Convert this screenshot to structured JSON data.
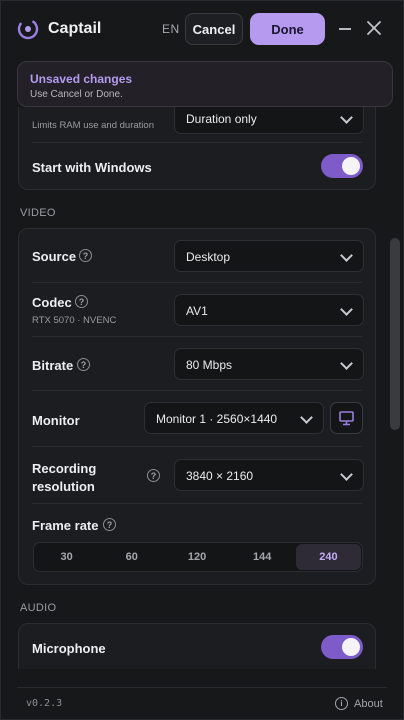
{
  "app": {
    "title": "Captail",
    "lang": "EN"
  },
  "toolbar": {
    "cancel_label": "Cancel",
    "done_label": "Done"
  },
  "banner": {
    "title": "Unsaved changes",
    "subtitle": "Use Cancel or Done."
  },
  "general": {
    "limit_row": {
      "sub": "Limits RAM use and duration",
      "value": "Duration only"
    },
    "start_with_windows": {
      "label": "Start with Windows",
      "on": true
    }
  },
  "video": {
    "section_title": "VIDEO",
    "source": {
      "label": "Source",
      "value": "Desktop"
    },
    "codec": {
      "label": "Codec",
      "sub": "RTX 5070 · NVENC",
      "value": "AV1"
    },
    "bitrate": {
      "label": "Bitrate",
      "value": "80 Mbps"
    },
    "monitor": {
      "label": "Monitor",
      "value": "Monitor 1 · 2560×1440"
    },
    "resolution": {
      "label_line1": "Recording",
      "label_line2": "resolution",
      "value": "3840 × 2160"
    },
    "frame_rate": {
      "label": "Frame rate",
      "options": [
        "30",
        "60",
        "120",
        "144",
        "240"
      ],
      "selected": "240"
    }
  },
  "audio": {
    "section_title": "AUDIO",
    "microphone": {
      "label": "Microphone",
      "on": true
    }
  },
  "footer": {
    "version": "v0.2.3",
    "about": "About"
  },
  "colors": {
    "accent": "#b59af0",
    "toggle_on": "#7d5bc8",
    "background": "#17181a"
  },
  "icons": {
    "help": "?",
    "info": "i"
  }
}
